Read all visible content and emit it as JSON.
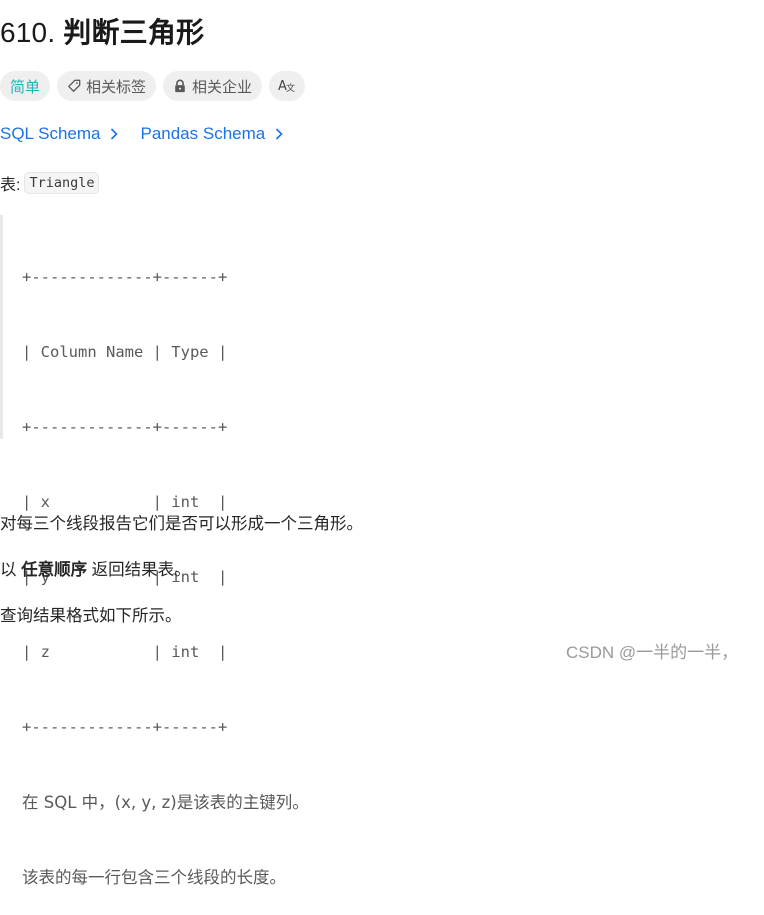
{
  "problem": {
    "number": "610.",
    "title": "判断三角形"
  },
  "tags": {
    "difficulty": "简单",
    "related_tags": "相关标签",
    "related_companies": "相关企业",
    "language_icon_label": "A文",
    "colors": {
      "easy": "#1cb8b8",
      "link": "#1a73e8"
    }
  },
  "schema_links": [
    {
      "label": "SQL Schema",
      "icon": "chevron-right-icon"
    },
    {
      "label": "Pandas Schema",
      "icon": "chevron-right-icon"
    }
  ],
  "table_intro": {
    "label": "表:",
    "table_name": "Triangle"
  },
  "schema_block": {
    "border_top": "+-------------+------+",
    "header": "| Column Name | Type |",
    "border_mid": "+-------------+------+",
    "rows": [
      "| x           | int  |",
      "| y           | int  |",
      "| z           | int  |"
    ],
    "border_bottom": "+-------------+------+",
    "notes": [
      "在 SQL 中，(x, y, z)是该表的主键列。",
      "该表的每一行包含三个线段的长度。"
    ]
  },
  "description": {
    "p1": "对每三个线段报告它们是否可以形成一个三角形。",
    "p2_prefix": "以 ",
    "p2_bold": "任意顺序",
    "p2_suffix": " 返回结果表。",
    "p3": "查询结果格式如下所示。"
  },
  "watermark": "CSDN @一半的一半，"
}
